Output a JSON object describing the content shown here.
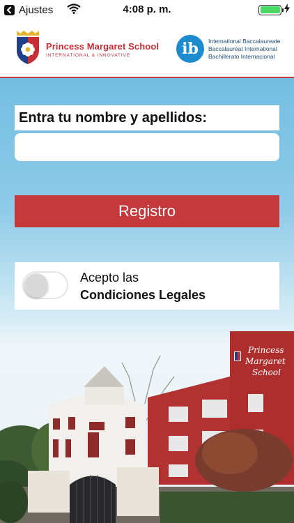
{
  "status_bar": {
    "back_label": "Ajustes",
    "time": "4:08 p. m."
  },
  "header": {
    "school_name": "Princess Margaret School",
    "school_tagline": "INTERNATIONAL & INNOVATIVE",
    "ib_lines": [
      "International Baccalaureate",
      "Baccalauréat International",
      "Bachillerato Internacional"
    ]
  },
  "form": {
    "name_label": "Entra tu nombre y apellidos:",
    "name_value": "",
    "register_label": "Registro",
    "terms_line1": "Acepto las",
    "terms_line2": "Condiciones Legales",
    "terms_accepted": false
  },
  "photo": {
    "sign_line1": "Princess",
    "sign_line2": "Margaret",
    "sign_line3": "School"
  },
  "colors": {
    "accent_red": "#c5383b",
    "sky_blue": "#64b6de",
    "ib_blue": "#1d8cce",
    "battery_green": "#4cd964"
  }
}
